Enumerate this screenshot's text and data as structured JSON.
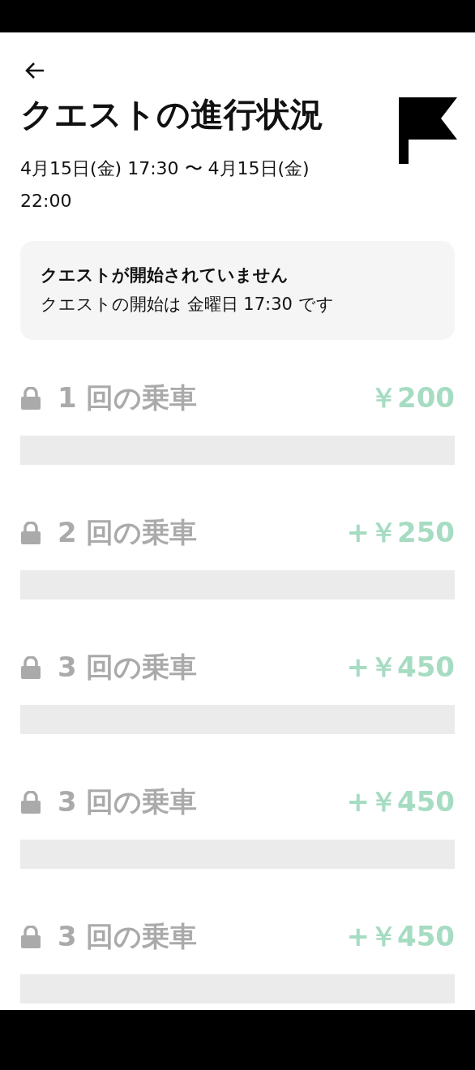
{
  "title": "クエストの進行状況",
  "period": "4月15日(金) 17:30 〜 4月15日(金) 22:00",
  "notice": {
    "title": "クエストが開始されていません",
    "message": "クエストの開始は 金曜日 17:30 です"
  },
  "steps": [
    {
      "label": "1 回の乗車",
      "reward": "￥200",
      "locked": true,
      "level": 0
    },
    {
      "label": "2 回の乗車",
      "reward": "+￥250",
      "locked": true,
      "level": 0
    },
    {
      "label": "3 回の乗車",
      "reward": "+￥450",
      "locked": true,
      "level": 0
    },
    {
      "label": "3 回の乗車",
      "reward": "+￥450",
      "locked": true,
      "level": 0
    },
    {
      "label": "3 回の乗車",
      "reward": "+￥450",
      "locked": true,
      "level": 0
    }
  ]
}
